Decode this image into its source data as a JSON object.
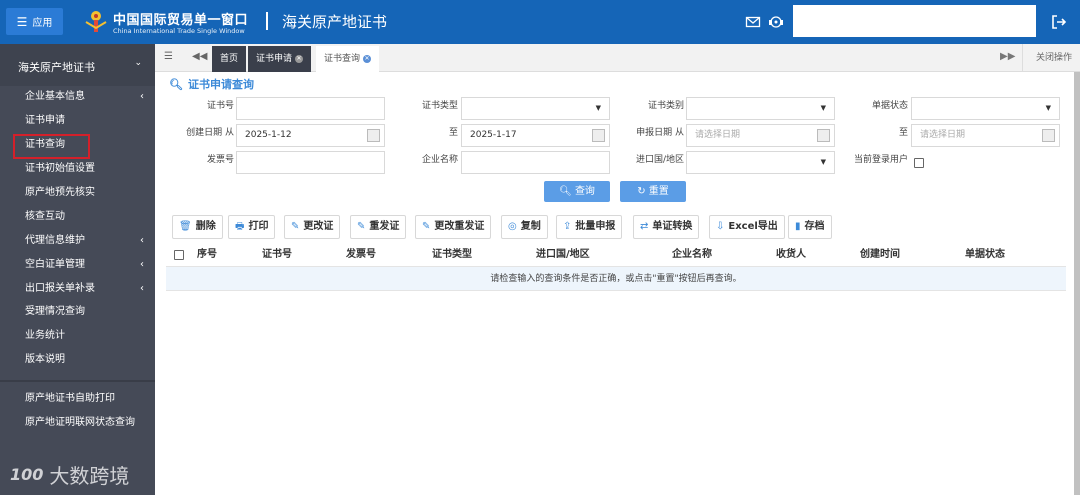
{
  "header": {
    "app_button": "应用",
    "brand_cn": "中国国际贸易单一窗口",
    "brand_en": "China International Trade Single Window",
    "title": "海关原产地证书",
    "search_value": ""
  },
  "sidebar": {
    "section": "海关原产地证书",
    "items": [
      {
        "label": "企业基本信息",
        "arrow": "‹"
      },
      {
        "label": "证书申请",
        "arrow": ""
      },
      {
        "label": "证书查询",
        "arrow": ""
      },
      {
        "label": "证书初始值设置",
        "arrow": ""
      },
      {
        "label": "原产地预先核实",
        "arrow": ""
      },
      {
        "label": "核查互动",
        "arrow": ""
      },
      {
        "label": "代理信息维护",
        "arrow": "‹"
      },
      {
        "label": "空白证单管理",
        "arrow": "‹"
      },
      {
        "label": "出口报关单补录",
        "arrow": "‹"
      },
      {
        "label": "受理情况查询",
        "arrow": ""
      },
      {
        "label": "业务统计",
        "arrow": ""
      },
      {
        "label": "版本说明",
        "arrow": ""
      }
    ],
    "extra_items": [
      {
        "label": "原产地证书自助打印"
      },
      {
        "label": "原产地证明联网状态查询"
      }
    ],
    "watermark": "大数跨境",
    "watermark_logo": "100"
  },
  "tabs": {
    "items": [
      {
        "label": "首页"
      },
      {
        "label": "证书申请"
      },
      {
        "label": "证书查询"
      }
    ],
    "close_ops": "关闭操作"
  },
  "query": {
    "title": "证书申请查询",
    "labels": {
      "cert_no": "证书号",
      "cert_type": "证书类型",
      "cert_category": "证书类别",
      "doc_status": "单据状态",
      "created_from": "创建日期  从",
      "to1": "至",
      "declare_from": "申报日期  从",
      "to2": "至",
      "invoice_no": "发票号",
      "company": "企业名称",
      "country": "进口国/地区",
      "current_user": "当前登录用户"
    },
    "values": {
      "created_from": "2025-1-12",
      "created_to": "2025-1-17",
      "declare_placeholder_from": "请选择日期",
      "declare_placeholder_to": "请选择日期"
    },
    "buttons": {
      "search": "查询",
      "reset": "重置"
    }
  },
  "toolbar": [
    {
      "icon": "🗑",
      "label": "删除"
    },
    {
      "icon": "🖶",
      "label": "打印"
    },
    {
      "icon": "✎",
      "label": "更改证"
    },
    {
      "icon": "✎",
      "label": "重发证"
    },
    {
      "icon": "✎",
      "label": "更改重发证"
    },
    {
      "icon": "◎",
      "label": "复制"
    },
    {
      "icon": "⇪",
      "label": "批量申报"
    },
    {
      "icon": "⇄",
      "label": "单证转换"
    },
    {
      "icon": "⇩",
      "label": "Excel导出"
    },
    {
      "icon": "▮",
      "label": "存档"
    }
  ],
  "table": {
    "columns": [
      "序号",
      "证书号",
      "发票号",
      "证书类型",
      "进口国/地区",
      "企业名称",
      "收货人",
      "创建时间",
      "单据状态"
    ],
    "empty_message": "请检查输入的查询条件是否正确，或点击\"重置\"按钮后再查询。"
  },
  "colors": {
    "header": "#1565b7",
    "sidebar": "#454a57",
    "accent": "#3d8ad8",
    "highlight_box": "#d4202a"
  }
}
